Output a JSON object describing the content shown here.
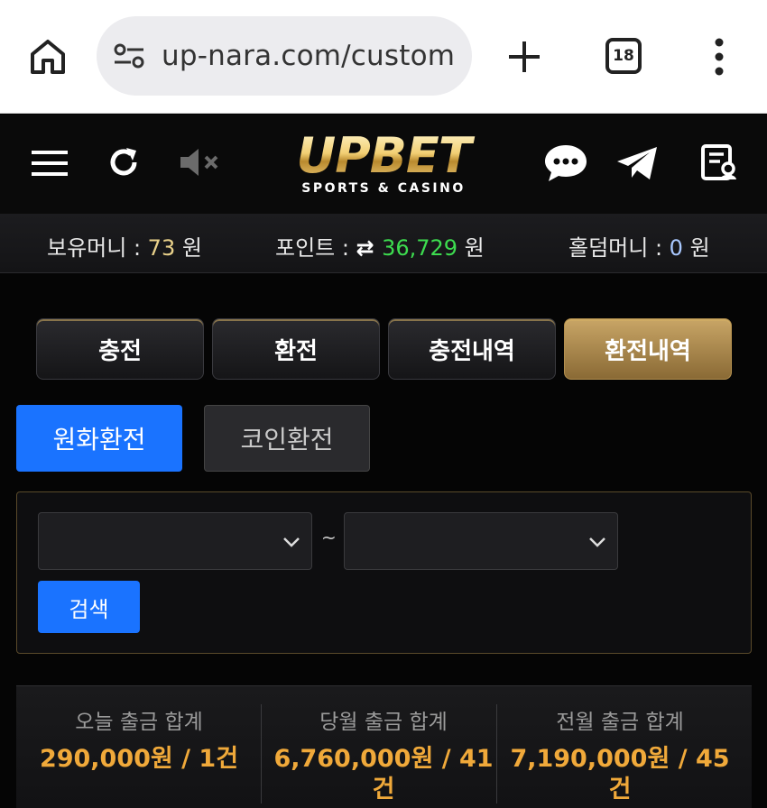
{
  "browser": {
    "url": "up-nara.com/custom",
    "tab_count": "18"
  },
  "header": {
    "logo_text": "UPBET",
    "logo_sub": "SPORTS & CASINO"
  },
  "balance": {
    "money_label": "보유머니 : ",
    "money_value": "73",
    "money_unit": " 원",
    "point_label": "포인트 : ",
    "point_value": "36,729",
    "point_unit": " 원",
    "holdem_label": "홀덤머니 : ",
    "holdem_value": "0",
    "holdem_unit": " 원"
  },
  "tabs": [
    {
      "label": "충전",
      "active": false
    },
    {
      "label": "환전",
      "active": false
    },
    {
      "label": "충전내역",
      "active": false
    },
    {
      "label": "환전내역",
      "active": true
    }
  ],
  "subtabs": [
    {
      "label": "원화환전",
      "active": true
    },
    {
      "label": "코인환전",
      "active": false
    }
  ],
  "search": {
    "tilde": "~",
    "button": "검색"
  },
  "summary": [
    {
      "label": "오늘 출금 합계",
      "value": "290,000원 / 1건"
    },
    {
      "label": "당월 출금 합계",
      "value": "6,760,000원 / 41건"
    },
    {
      "label": "전월 출금 합계",
      "value": "7,190,000원 / 45건"
    }
  ],
  "colors": {
    "accent_blue": "#1a73ff",
    "gold": "#c8a566",
    "amount_orange": "#f0a93a",
    "point_green": "#3ddc4f"
  }
}
